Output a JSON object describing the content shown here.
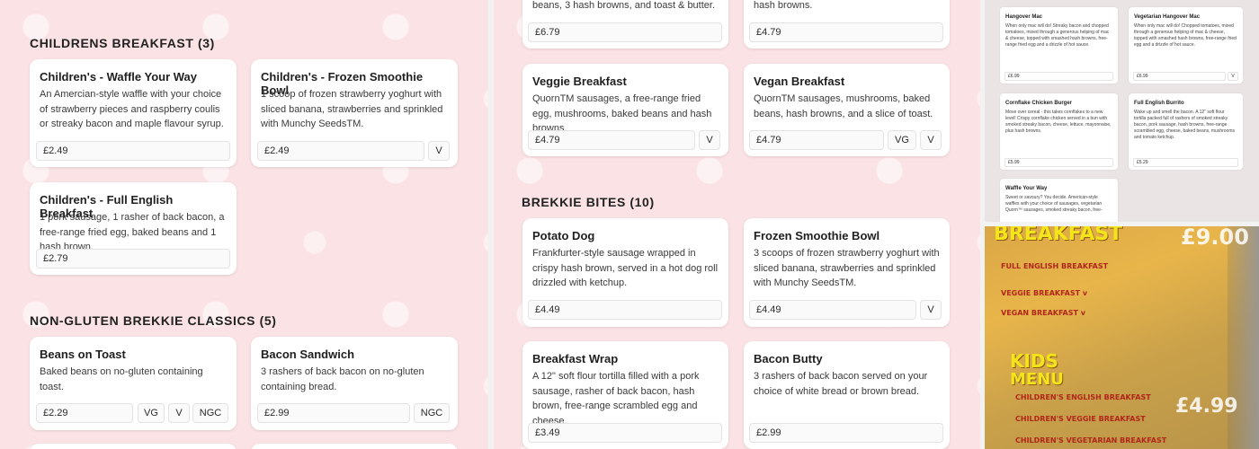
{
  "childrens_breakfast": {
    "heading": "CHILDRENS BREAKFAST (3)",
    "items": [
      {
        "title": "Children's - Waffle Your Way",
        "description": "An Amercian-style waffle with your choice of strawberry pieces and raspberry coulis or streaky bacon and maple flavour syrup.",
        "price": "£2.49",
        "tags": []
      },
      {
        "title": "Children's - Frozen Smoothie Bowl",
        "description": "1 scoop of frozen strawberry yoghurt with sliced banana, strawberries and sprinkled with Munchy SeedsTM.",
        "price": "£2.49",
        "tags": [
          "V"
        ]
      },
      {
        "title": "Children's - Full English Breakfast",
        "description": "1 pork sausage, 1 rasher of back bacon, a free-range fried egg, baked beans and 1 hash brown.",
        "price": "£2.79",
        "tags": []
      }
    ]
  },
  "non_gluten": {
    "heading": "NON-GLUTEN BREKKIE CLASSICS (5)",
    "items": [
      {
        "title": "Beans on Toast",
        "description": "Baked beans on no-gluten containing toast.",
        "price": "£2.29",
        "tags": [
          "VG",
          "V",
          "NGC"
        ]
      },
      {
        "title": "Bacon Sandwich",
        "description": "3 rashers of back bacon on no-gluten containing bread.",
        "price": "£2.99",
        "tags": [
          "NGC"
        ]
      }
    ]
  },
  "classics_partial": {
    "items": [
      {
        "description": "beans, 3 hash browns, and toast & butter.",
        "price": "£6.79",
        "tags": []
      },
      {
        "description": "hash browns.",
        "price": "£4.79",
        "tags": []
      },
      {
        "title": "Veggie Breakfast",
        "description": "QuornTM sausages, a free-range fried egg, mushrooms, baked beans and hash browns.",
        "price": "£4.79",
        "tags": [
          "V"
        ]
      },
      {
        "title": "Vegan Breakfast",
        "description": "QuornTM sausages, mushrooms, baked beans, hash browns, and a slice of toast.",
        "price": "£4.79",
        "tags": [
          "VG",
          "V"
        ]
      }
    ]
  },
  "brekkie_bites": {
    "heading": "BREKKIE BITES (10)",
    "items": [
      {
        "title": "Potato Dog",
        "description": "Frankfurter-style sausage wrapped in crispy hash brown, served in a hot dog roll drizzled with ketchup.",
        "price": "£4.49",
        "tags": []
      },
      {
        "title": "Frozen Smoothie Bowl",
        "description": "3 scoops of frozen strawberry yoghurt with sliced banana, strawberries and sprinkled with Munchy SeedsTM.",
        "price": "£4.49",
        "tags": [
          "V"
        ]
      },
      {
        "title": "Breakfast Wrap",
        "description": "A 12\" soft flour tortilla filled with a pork sausage, rasher of back bacon, hash brown, free-range scrambled egg and cheese.",
        "price": "£3.49",
        "tags": []
      },
      {
        "title": "Bacon Butty",
        "description": "3 rashers of back bacon served on your choice of white bread or brown bread.",
        "price": "£2.99",
        "tags": []
      }
    ]
  },
  "thumbnail": {
    "header_fragment": "...",
    "items": [
      {
        "title": "Hangover Mac",
        "description": "When only mac will do! Streaky bacon and chopped tomatoes, mixed through a generous helping of mac & cheese, topped with smashed hash browns, free-range fried egg and a drizzle of hot sauce.",
        "price": "£6.99",
        "tags": []
      },
      {
        "title": "Vegetarian Hangover Mac",
        "description": "When only mac will do! Chopped tomatoes, mixed through a generous helping of mac & cheese, topped with smashed hash browns, free-range fried egg and a drizzle of hot sauce.",
        "price": "£6.99",
        "tags": [
          "V"
        ]
      },
      {
        "title": "Cornflake Chicken Burger",
        "description": "Move over cereal - this takes cornflakes to a new level! Crispy cornflake chicken served in a bun with smoked streaky bacon, cheese, lettuce, mayonnaise, plus hash browns.",
        "price": "£5.99",
        "tags": []
      },
      {
        "title": "Full English Burrito",
        "description": "Wake up and smell the bacon. A 12\" soft flour tortilla packed full of rashers of smoked streaky bacon, pork sausage, hash browns, free-range scrambled egg, cheese, baked beans, mushrooms and tomato ketchup.",
        "price": "£5.29",
        "tags": []
      },
      {
        "title": "Waffle Your Way",
        "description": "Sweet or savoury? You decide. American-style waffles with your choice of sausages, vegetarian Quorn™ sausages, smoked streaky bacon, free-",
        "price": "",
        "tags": []
      }
    ]
  },
  "photo": {
    "heading": "BREAKFAST",
    "price_top": "£9.00",
    "lines": [
      "FULL ENGLISH BREAKFAST",
      "VEGGIE BREAKFAST v",
      "VEGAN BREAKFAST v"
    ],
    "kids_heading": "KIDS",
    "kids_sub": "MENU",
    "kids_lines": [
      "CHILDREN'S ENGLISH BREAKFAST",
      "CHILDREN'S VEGGIE BREAKFAST",
      "CHILDREN'S VEGETARIAN BREAKFAST"
    ],
    "price_bottom": "£4.99"
  }
}
